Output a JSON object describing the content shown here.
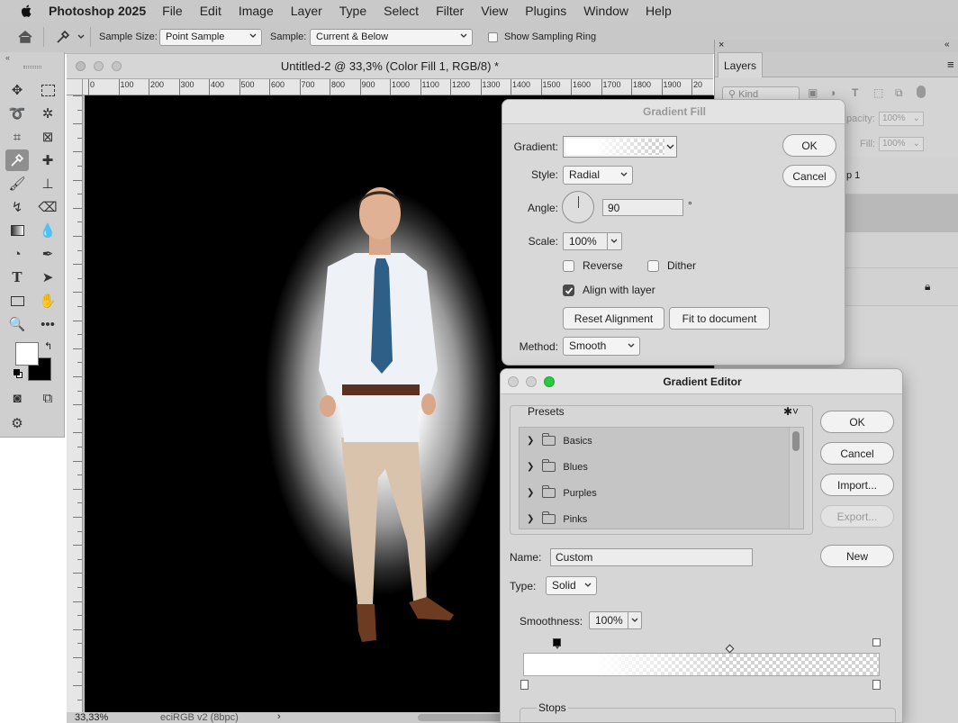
{
  "menubar": {
    "app_name": "Photoshop 2025",
    "items": [
      "File",
      "Edit",
      "Image",
      "Layer",
      "Type",
      "Select",
      "Filter",
      "View",
      "Plugins",
      "Window",
      "Help"
    ]
  },
  "options_bar": {
    "sample_size_label": "Sample Size:",
    "sample_size_value": "Point Sample",
    "sample_label": "Sample:",
    "sample_value": "Current & Below",
    "show_ring_label": "Show Sampling Ring"
  },
  "document": {
    "title": "Untitled-2 @ 33,3% (Color Fill 1, RGB/8) *",
    "ruler_ticks": [
      "0",
      "100",
      "200",
      "300",
      "400",
      "500",
      "600",
      "700",
      "800",
      "900",
      "1000",
      "1100",
      "1200",
      "1300",
      "1400",
      "1500",
      "1600",
      "1700",
      "1800",
      "1900",
      "20"
    ],
    "zoom": "33,33%",
    "color_profile": "eciRGB v2 (8bpc)"
  },
  "layers_panel": {
    "tab_label": "Layers",
    "kind_label": "Kind",
    "opacity_label": "pacity:",
    "opacity_value": "100%",
    "fill_label": "Fill:",
    "fill_value": "100%",
    "layer_partial": "p 1"
  },
  "gradient_fill": {
    "title": "Gradient Fill",
    "gradient_label": "Gradient:",
    "style_label": "Style:",
    "style_value": "Radial",
    "angle_label": "Angle:",
    "angle_value": "90",
    "degree": "°",
    "scale_label": "Scale:",
    "scale_value": "100%",
    "reverse_label": "Reverse",
    "dither_label": "Dither",
    "align_label": "Align with layer",
    "reset_alignment": "Reset Alignment",
    "fit_to_document": "Fit to document",
    "method_label": "Method:",
    "method_value": "Smooth",
    "ok": "OK",
    "cancel": "Cancel"
  },
  "gradient_editor": {
    "title": "Gradient Editor",
    "presets_label": "Presets",
    "presets": [
      "Basics",
      "Blues",
      "Purples",
      "Pinks"
    ],
    "name_label": "Name:",
    "name_value": "Custom",
    "type_label": "Type:",
    "type_value": "Solid",
    "smoothness_label": "Smoothness:",
    "smoothness_value": "100%",
    "stops_label": "Stops",
    "ok": "OK",
    "cancel": "Cancel",
    "import": "Import...",
    "export": "Export...",
    "new": "New"
  },
  "colors": {
    "foreground": "#ffffff",
    "background": "#000000",
    "traffic_close": "#d8d8d8",
    "traffic_min": "#d8d8d8",
    "traffic_zoom": "#2ac940"
  }
}
